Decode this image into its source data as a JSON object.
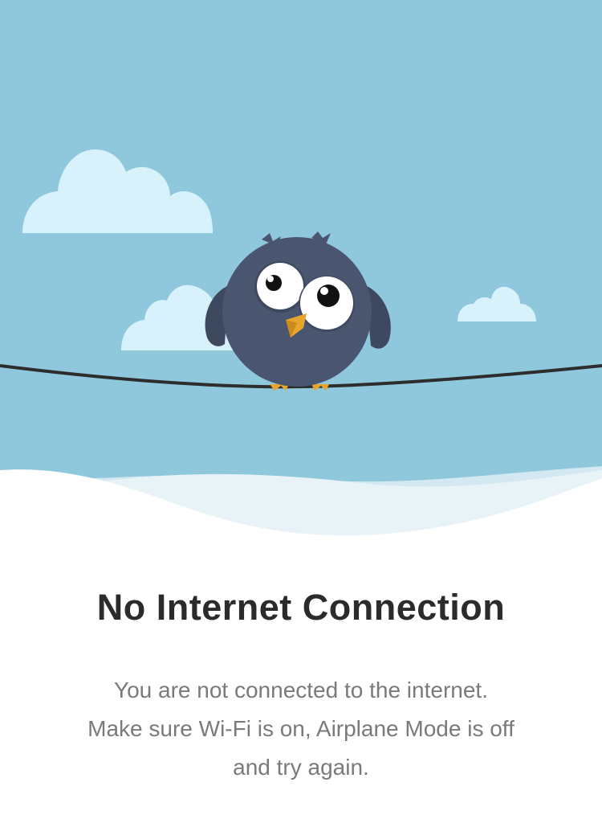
{
  "illustration": {
    "description_icon": "owl-on-wire-icon",
    "colors": {
      "sky": "#8fc8dc",
      "cloud": "#d8f2fc",
      "owl_body": "#4a5670",
      "owl_wing": "#3e4960",
      "eye_white": "#ffffff",
      "pupil": "#111111",
      "beak": "#e8a52c",
      "wire": "#2d2d2d",
      "snow_light": "#e8f3f8",
      "snow_mid": "#d3e8f1"
    }
  },
  "error": {
    "title": "No Internet Connection",
    "message_lines": [
      "You are not connected to the internet.",
      "Make sure Wi-Fi is on, Airplane Mode is off",
      "and try again."
    ]
  }
}
